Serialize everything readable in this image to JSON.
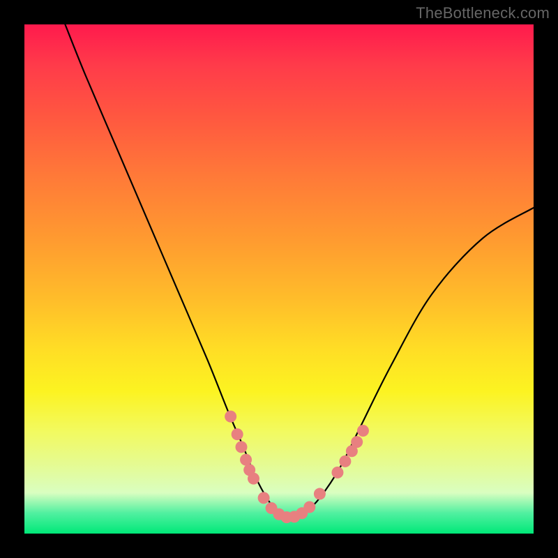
{
  "watermark": "TheBottleneck.com",
  "chart_data": {
    "type": "line",
    "title": "",
    "xlabel": "",
    "ylabel": "",
    "xlim": [
      0,
      100
    ],
    "ylim": [
      0,
      100
    ],
    "grid": false,
    "series": [
      {
        "name": "curve",
        "x": [
          8,
          12,
          18,
          24,
          30,
          36,
          40,
          43,
          45,
          47,
          49,
          51,
          53,
          55,
          58,
          62,
          66,
          72,
          80,
          90,
          100
        ],
        "y": [
          100,
          90,
          76,
          62,
          48,
          34,
          24,
          17,
          12,
          8,
          5,
          3,
          3,
          4,
          7,
          13,
          21,
          33,
          47,
          58,
          64
        ]
      }
    ],
    "markers": {
      "name": "salmon-dots",
      "points": [
        {
          "x": 40.5,
          "y": 23
        },
        {
          "x": 41.8,
          "y": 19.5
        },
        {
          "x": 42.6,
          "y": 17
        },
        {
          "x": 43.5,
          "y": 14.5
        },
        {
          "x": 44.2,
          "y": 12.5
        },
        {
          "x": 45.0,
          "y": 10.8
        },
        {
          "x": 47.0,
          "y": 7.0
        },
        {
          "x": 48.5,
          "y": 5.0
        },
        {
          "x": 50.0,
          "y": 3.8
        },
        {
          "x": 51.5,
          "y": 3.2
        },
        {
          "x": 53.0,
          "y": 3.3
        },
        {
          "x": 54.5,
          "y": 4.0
        },
        {
          "x": 56.0,
          "y": 5.2
        },
        {
          "x": 58.0,
          "y": 7.8
        },
        {
          "x": 61.5,
          "y": 12.0
        },
        {
          "x": 63.0,
          "y": 14.2
        },
        {
          "x": 64.3,
          "y": 16.2
        },
        {
          "x": 65.3,
          "y": 18.0
        },
        {
          "x": 66.5,
          "y": 20.2
        }
      ]
    },
    "colors": {
      "curve": "#000000",
      "markers": "#e88080",
      "gradient_top": "#ff1a4d",
      "gradient_bottom": "#00e878",
      "frame": "#000000"
    }
  }
}
